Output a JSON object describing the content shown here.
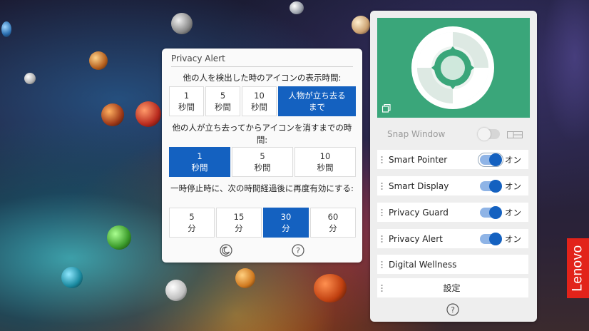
{
  "colors": {
    "accent": "#1461c0",
    "hero_bg": "#3aa67a",
    "brand": "#e2231a"
  },
  "privacy_alert": {
    "title": "Privacy Alert",
    "q1": "他の人を検出した時のアイコンの表示時間:",
    "q1_options": [
      "1\n秒間",
      "5\n秒間",
      "10\n秒間",
      "人物が立ち去る\nまで"
    ],
    "q2": "他の人が立ち去ってからアイコンを消すまでの時間:",
    "q2_options": [
      "1\n秒間",
      "5\n秒間",
      "10\n秒間"
    ],
    "q3": "一時停止時に、次の時間経過後に再度有効にする:",
    "q3_options": [
      "5\n分",
      "15\n分",
      "30\n分",
      "60\n分"
    ],
    "footer_icons": [
      "moon-icon",
      "help-icon"
    ],
    "help_glyph": "?"
  },
  "side": {
    "snap_window": "Snap Window",
    "rows": [
      {
        "label": "Smart Pointer",
        "state": "オン"
      },
      {
        "label": "Smart Display",
        "state": "オン"
      },
      {
        "label": "Privacy Guard",
        "state": "オン"
      },
      {
        "label": "Privacy Alert",
        "state": "オン"
      }
    ],
    "digital_wellness": "Digital Wellness",
    "settings": "設定",
    "help_glyph": "?"
  },
  "brand": {
    "logo_text": "Lenovo"
  }
}
